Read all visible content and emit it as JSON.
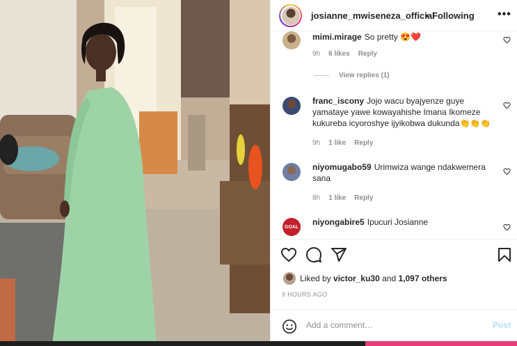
{
  "post": {
    "username": "josianne_mwiseneza_official",
    "separator": "•",
    "follow_label": "Following",
    "more_label": "•••",
    "liked_prefix": "Liked by",
    "liked_user": "victor_ku30",
    "liked_and": "and",
    "liked_others": "1,097 others",
    "time_ago": "9 HOURS AGO",
    "add_comment_placeholder": "Add a comment…",
    "post_label": "Post"
  },
  "comments": [
    {
      "user": "mimi.mirage",
      "text": "So pretty 😍❤️",
      "time": "9h",
      "likes": "6 likes",
      "reply": "Reply",
      "avatar_color": "#c9b28a"
    },
    {
      "user": "franc_iscony",
      "text": "Jojo wacu byajyenze guye yamataye yawe kowayahishe Imana Ikomeze kukureba icyoroshye ijyikobwa dukunda👏👏👏",
      "time": "9h",
      "likes": "1 like",
      "reply": "Reply",
      "avatar_color": "#3a4a70"
    },
    {
      "user": "niyomugabo59",
      "text": "Urimwiza wange ndakwemera sana",
      "time": "8h",
      "likes": "1 like",
      "reply": "Reply",
      "avatar_color": "#6f7fa6"
    },
    {
      "user": "niyongabire5",
      "text": "Ipucuri Josianne",
      "avatar_color": "#c21f2a",
      "avatar_text": "GOAL"
    }
  ],
  "view_replies_label": "View replies (1)",
  "icons": [
    "heart-icon",
    "comment-icon",
    "share-icon",
    "bookmark-icon",
    "emoji-icon",
    "more-icon"
  ],
  "colors": {
    "accent_pink": "#e43f7a",
    "post_button": "#b2dffc",
    "meta_gray": "#8e8e8e"
  }
}
